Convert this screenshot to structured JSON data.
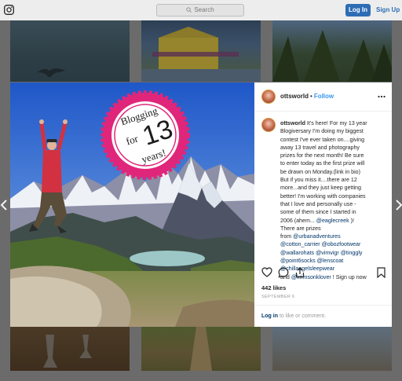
{
  "nav": {
    "logo_icon": "instagram-logo-icon",
    "search_placeholder": "Search",
    "login_label": "Log In",
    "signup_label": "Sign Up",
    "accent": "#3897f0"
  },
  "post": {
    "username": "ottsworld",
    "dot": "•",
    "follow_label": "Follow",
    "badge": {
      "line1": "Blogging",
      "line2": "for",
      "number": "13",
      "line3": "years!"
    },
    "caption_lines": [
      "It's here! For my 13 year",
      "Blogiversary I'm doing my biggest",
      "contest I've ever taken on....giving",
      "away 13 travel and photography",
      "prizes for the next month! Be sure",
      "to enter today as the first prize will",
      "be drawn on Monday.(link in bio)",
      "But if you miss it....there are 12",
      "more...and they just keep getting",
      "better! I'm working with companies",
      "that I love and personally use -",
      "some of them since I started in",
      "2006 (ahem... ",
      "There are prizes",
      "from "
    ],
    "mentions": {
      "eaglecreek": "@eaglecreek",
      "eaglecreek_after": " )!",
      "urbanadventures": "@urbanadventures",
      "cotton_carrier": "@cotton_carrier",
      "obozfootwear": "@obozfootwear",
      "wallarooHats": "@wallarohats",
      "vimvigr": "@vimvigr",
      "tinggly": "@tinggly",
      "point6socks": "@point6socks",
      "lenscoat": "@lenscoat",
      "chillangelsleepwear": "@chillangelsleepwear",
      "krimsonklover": "@krimsonklover",
      "and_prefix": "and ",
      "signup_suffix": " ! Sign up now"
    },
    "likes": "442 likes",
    "date": "SEPTEMBER 6",
    "comment_login": "Log in",
    "comment_rest": " to like or comment."
  }
}
